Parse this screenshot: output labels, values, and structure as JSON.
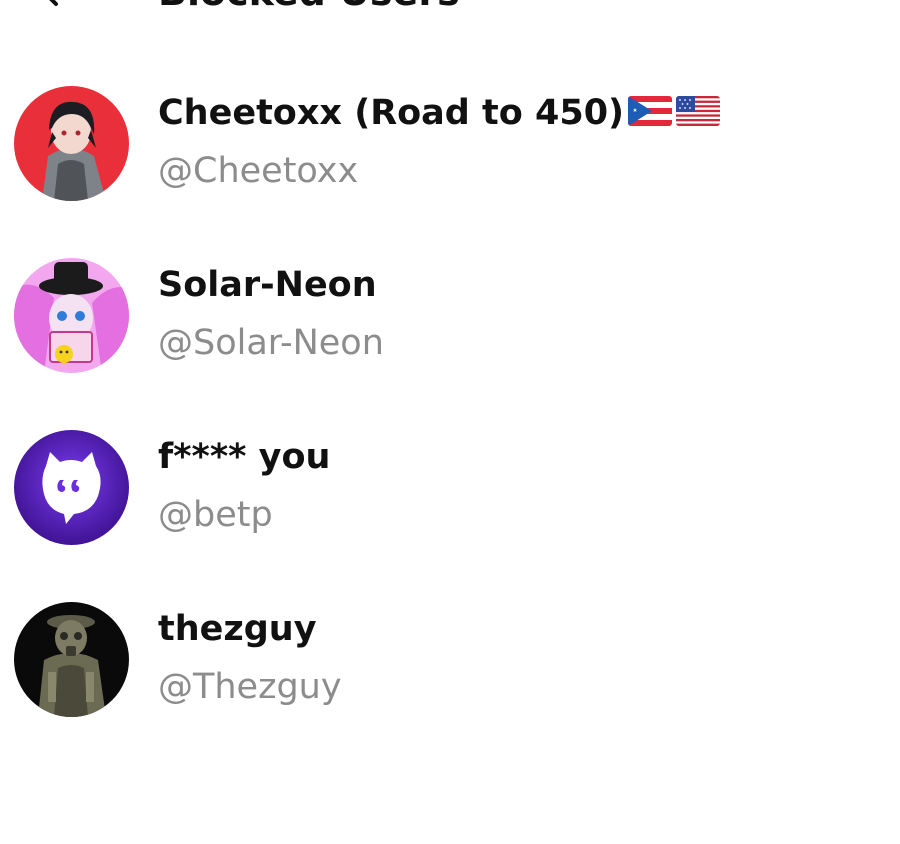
{
  "header": {
    "back_icon": "chevron-left-icon",
    "title": "Blocked Users"
  },
  "users": [
    {
      "name": "Cheetoxx (Road to 450)",
      "handle": "@Cheetoxx",
      "flags": [
        "puerto-rico-flag-icon",
        "united-states-flag-icon"
      ],
      "avatar_color": "#e9303a"
    },
    {
      "name": "Solar-Neon",
      "handle": "@Solar-Neon",
      "flags": [],
      "avatar_color": "#e36fe0"
    },
    {
      "name": "f**** you",
      "handle": "@betp",
      "flags": [],
      "avatar_color": "#5a1fb8"
    },
    {
      "name": "thezguy",
      "handle": "@Thezguy",
      "flags": [],
      "avatar_color": "#111111"
    }
  ]
}
